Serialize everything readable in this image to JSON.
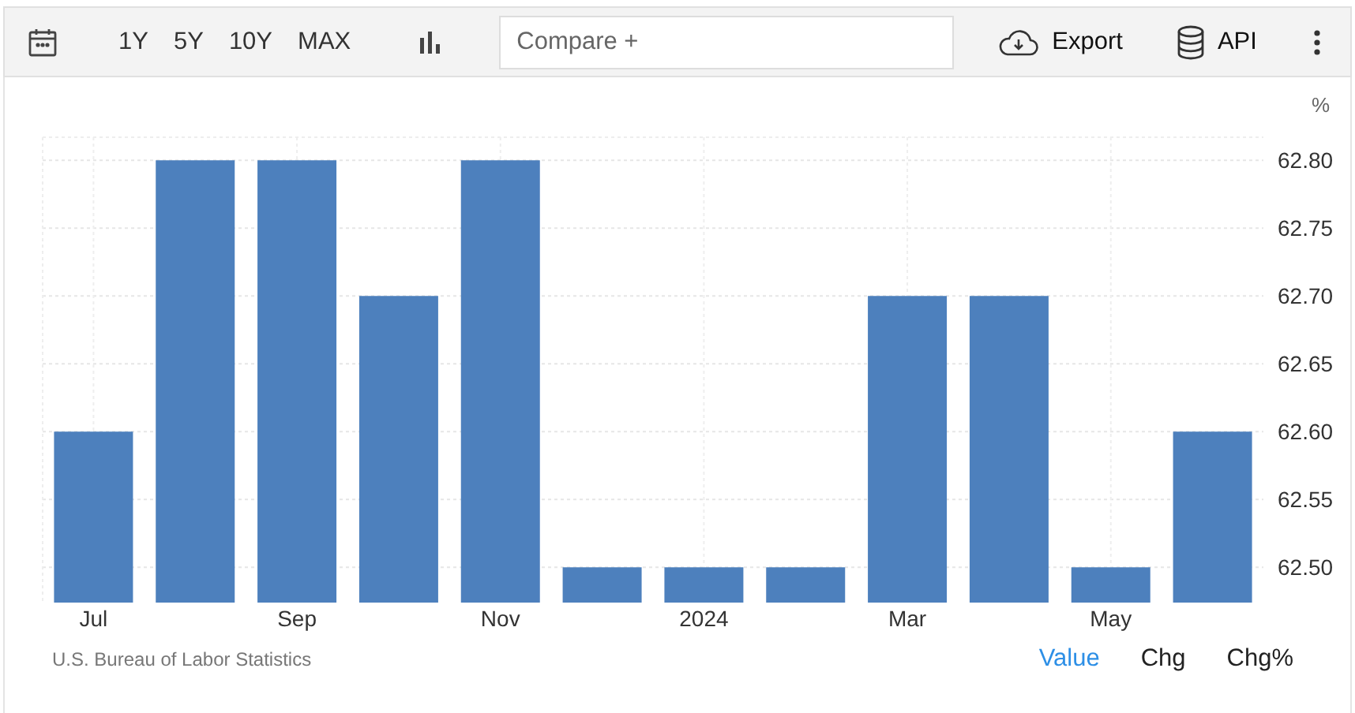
{
  "toolbar": {
    "ranges": [
      {
        "label": "1Y"
      },
      {
        "label": "5Y"
      },
      {
        "label": "10Y"
      },
      {
        "label": "MAX"
      }
    ],
    "compare": {
      "placeholder": "Compare +"
    },
    "actions": [
      {
        "kind": "export",
        "label": "Export"
      },
      {
        "kind": "api",
        "label": "API"
      }
    ]
  },
  "chart": {
    "chart_data": {
      "type": "bar",
      "ylabel": "%",
      "grid": true,
      "categories": [
        "Jul",
        null,
        "Sep",
        null,
        "Nov",
        null,
        "2024",
        null,
        "Mar",
        null,
        "May",
        null
      ],
      "series": [
        {
          "color": "#4d80bd",
          "values": [
            62.6,
            62.8,
            62.8,
            62.7,
            62.8,
            62.5,
            62.5,
            62.5,
            62.7,
            62.7,
            62.5,
            62.6
          ]
        }
      ],
      "ylim": [
        62.474,
        62.817
      ],
      "yticks": [
        {
          "value": 62.5,
          "label": "62.50"
        },
        {
          "value": 62.55,
          "label": "62.55"
        },
        {
          "value": 62.6,
          "label": "62.60"
        },
        {
          "value": 62.65,
          "label": "62.65"
        },
        {
          "value": 62.7,
          "label": "62.70"
        },
        {
          "value": 62.75,
          "label": "62.75"
        },
        {
          "value": 62.8,
          "label": "62.80"
        }
      ]
    }
  },
  "footer": {
    "source": "U.S. Bureau of Labor Statistics",
    "modes": [
      {
        "label": "Value",
        "selected": true
      },
      {
        "label": "Chg",
        "selected": false
      },
      {
        "label": "Chg%",
        "selected": false
      }
    ]
  }
}
